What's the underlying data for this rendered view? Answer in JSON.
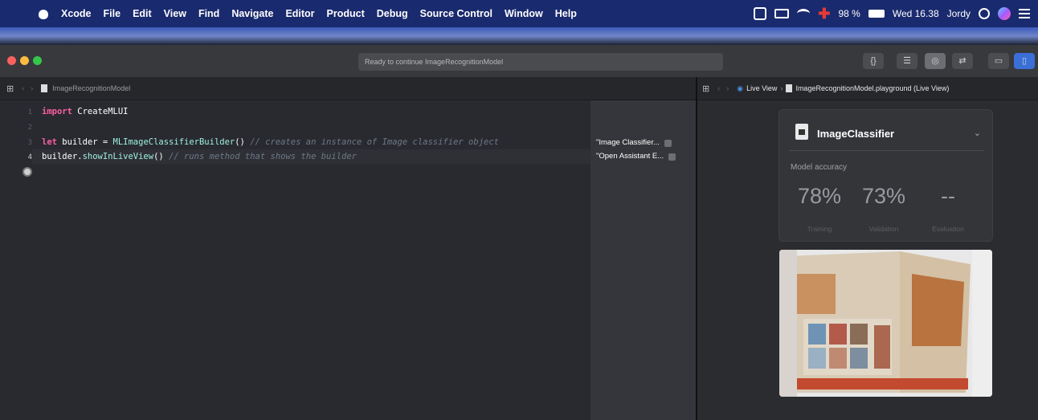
{
  "menubar": {
    "app_name": "Xcode",
    "items": [
      "File",
      "Edit",
      "View",
      "Find",
      "Navigate",
      "Editor",
      "Product",
      "Debug",
      "Source Control",
      "Window",
      "Help"
    ],
    "battery": "98 %",
    "clock": "Wed 16.38",
    "user": "Jordy"
  },
  "toolbar": {
    "status": "Ready to continue ImageRecognitionModel",
    "braces_label": "{}"
  },
  "editor": {
    "breadcrumb": "ImageRecognitionModel",
    "lines": [
      {
        "num": "1",
        "kw": "import",
        "rest": "CreateMLUI",
        "comment": ""
      },
      {
        "num": "2",
        "kw": "",
        "rest": "",
        "comment": ""
      },
      {
        "num": "3",
        "kw": "let",
        "pre": "builder = ",
        "cls": "MLImageClassifierBuilder",
        "post": "()",
        "comment": "// creates an instance of Image classifier object"
      },
      {
        "num": "4",
        "kw": "",
        "pre": "builder.",
        "cls": "showInLiveView",
        "post": "()",
        "comment": "// runs method that shows the builder"
      }
    ],
    "results": [
      "\"Image Classifier...",
      "\"Open Assistant E..."
    ]
  },
  "liveview": {
    "crumb_live": "Live View",
    "crumb_file": "ImageRecognitionModel.playground (Live View)",
    "card_title": "ImageClassifier",
    "accuracy_label": "Model accuracy",
    "metrics": [
      {
        "value": "78%",
        "label": "Training"
      },
      {
        "value": "73%",
        "label": "Validation"
      },
      {
        "value": "--",
        "label": "Evaluation"
      }
    ]
  }
}
